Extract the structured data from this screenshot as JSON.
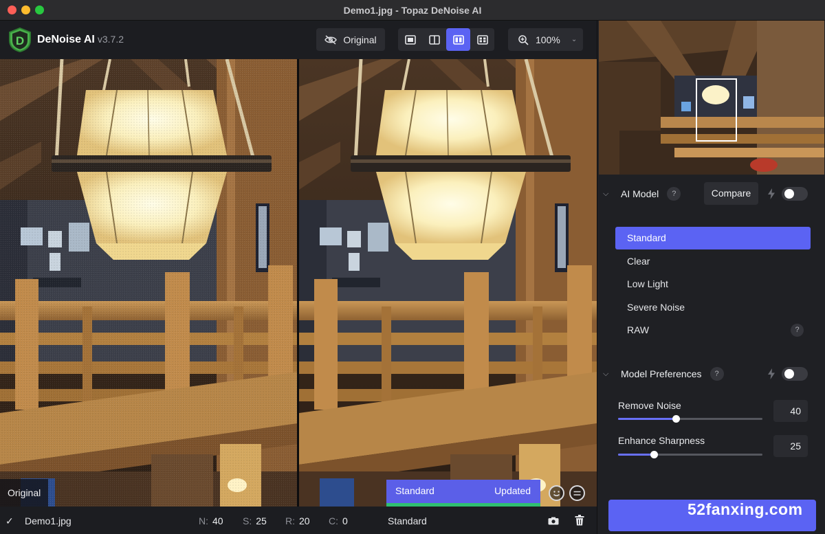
{
  "window": {
    "title": "Demo1.jpg - Topaz DeNoise AI"
  },
  "brand": {
    "name": "DeNoise AI",
    "version": "v3.7.2",
    "logo_letter": "D"
  },
  "toolbar": {
    "original_label": "Original",
    "view_modes": [
      "single-view-icon",
      "split-view-icon",
      "side-by-side-icon",
      "grid-view-icon"
    ],
    "active_view": 2,
    "zoom": "100%"
  },
  "preview": {
    "left_label": "Original",
    "strip_model": "Standard",
    "strip_status": "Updated"
  },
  "statusbar": {
    "filename": "Demo1.jpg",
    "n_key": "N:",
    "n_val": "40",
    "s_key": "S:",
    "s_val": "25",
    "r_key": "R:",
    "r_val": "20",
    "c_key": "C:",
    "c_val": "0",
    "model": "Standard"
  },
  "ai_model": {
    "title": "AI Model",
    "help": "?",
    "compare_label": "Compare",
    "items": [
      "Standard",
      "Clear",
      "Low Light",
      "Severe Noise",
      "RAW"
    ],
    "selected": 0,
    "raw_help": "?"
  },
  "preferences": {
    "title": "Model Preferences",
    "help": "?",
    "remove_noise": {
      "label": "Remove Noise",
      "value": "40",
      "fraction": 0.4
    },
    "enhance_sharpness": {
      "label": "Enhance Sharpness",
      "value": "25",
      "fraction": 0.25
    }
  },
  "watermark": "52fanxing.com",
  "colors": {
    "accent": "#5b63f3",
    "progress": "#2fbf71",
    "panel": "#1f2024"
  }
}
